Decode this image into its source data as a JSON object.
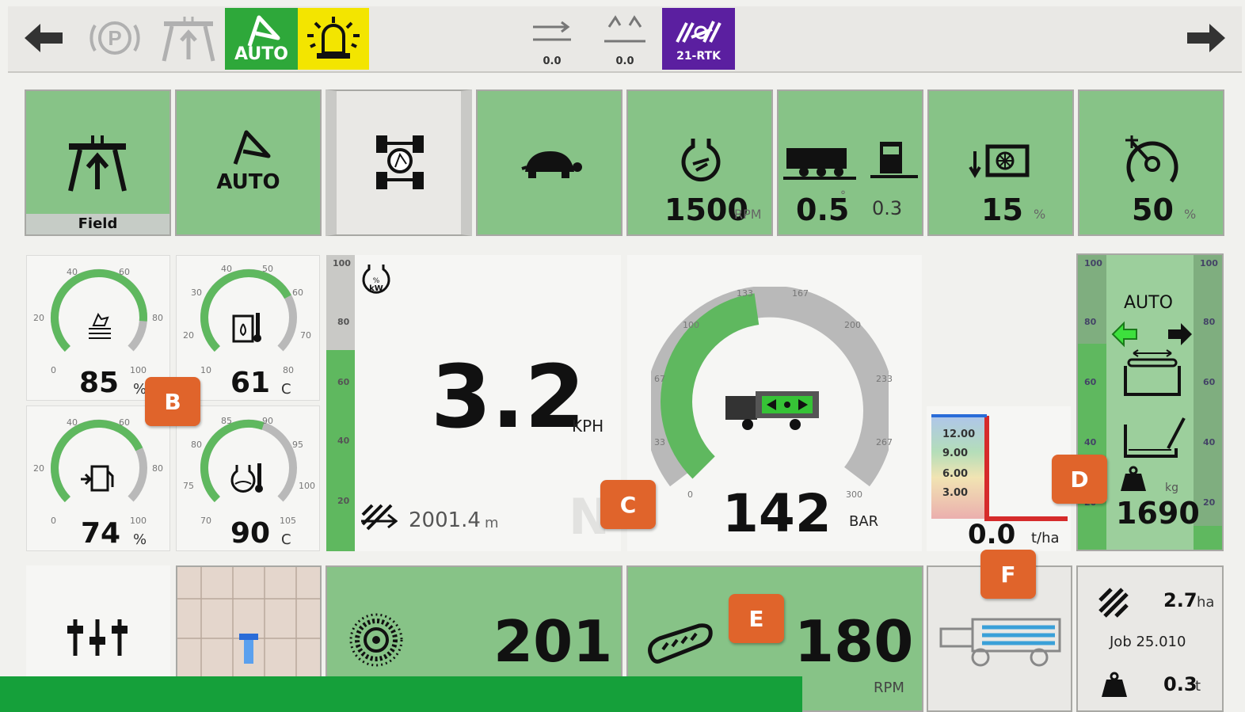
{
  "topbar": {
    "auto_label": "AUTO",
    "rtk_label": "21-RTK",
    "lateral_offset": "0.0",
    "heading_offset": "0.0",
    "colors": {
      "auto_bg": "#2ea83a",
      "beacon_bg": "#f3e500",
      "rtk_bg": "#5b1fa0"
    }
  },
  "tiles_row1": {
    "field_label": "Field",
    "auto_label": "AUTO",
    "engine_rpm": "1500",
    "engine_rpm_unit": "RPM",
    "header_height_main": "0.5",
    "header_height_degree": "°",
    "header_height_secondary": "0.3",
    "fan_percent": "15",
    "fan_unit": "%",
    "speed_percent": "50",
    "speed_unit": "%"
  },
  "gauges": {
    "g1": {
      "value": "85",
      "unit": "%",
      "ticks": [
        "0",
        "20",
        "40",
        "60",
        "80",
        "100"
      ],
      "fill": 0.85
    },
    "g2": {
      "value": "61",
      "unit": "C",
      "ticks": [
        "10",
        "20",
        "30",
        "40",
        "50",
        "60",
        "70",
        "80"
      ],
      "fill": 0.73
    },
    "g3": {
      "value": "74",
      "unit": "%",
      "ticks": [
        "0",
        "20",
        "40",
        "60",
        "80",
        "100"
      ],
      "fill": 0.74
    },
    "g4": {
      "value": "90",
      "unit": "C",
      "ticks": [
        "70",
        "75",
        "80",
        "85",
        "90",
        "95",
        "100",
        "105"
      ],
      "fill": 0.57
    }
  },
  "engine_load": {
    "ticks": [
      "100",
      "80",
      "60",
      "40",
      "20"
    ],
    "fill": 0.68,
    "icon_text": "% kW"
  },
  "speed": {
    "value": "3.2",
    "unit": "KPH",
    "distance": "2001.4",
    "distance_unit": "m",
    "gear": "N"
  },
  "pressure": {
    "value": "142",
    "unit": "BAR",
    "ticks": [
      "0",
      "33",
      "67",
      "100",
      "133",
      "167",
      "200",
      "233",
      "267",
      "300"
    ],
    "fill": 0.47
  },
  "yield_chart": {
    "ticks": [
      "12.00",
      "9.00",
      "6.00",
      "3.00"
    ],
    "value": "0.0",
    "unit": "t/ha"
  },
  "bunker": {
    "auto_label": "AUTO",
    "ticks": [
      "100",
      "80",
      "60",
      "40",
      "20"
    ],
    "weight": "1690",
    "weight_unit": "kg"
  },
  "bottom": {
    "rotor_speed": "201",
    "feeder_speed": "180",
    "feeder_unit": "RPM",
    "area": "2.7",
    "area_unit": "ha",
    "job": "Job 25.010",
    "job_weight": "0.3",
    "job_weight_unit": "t"
  },
  "badges": {
    "b": "B",
    "c": "C",
    "d": "D",
    "e": "E",
    "f": "F"
  }
}
